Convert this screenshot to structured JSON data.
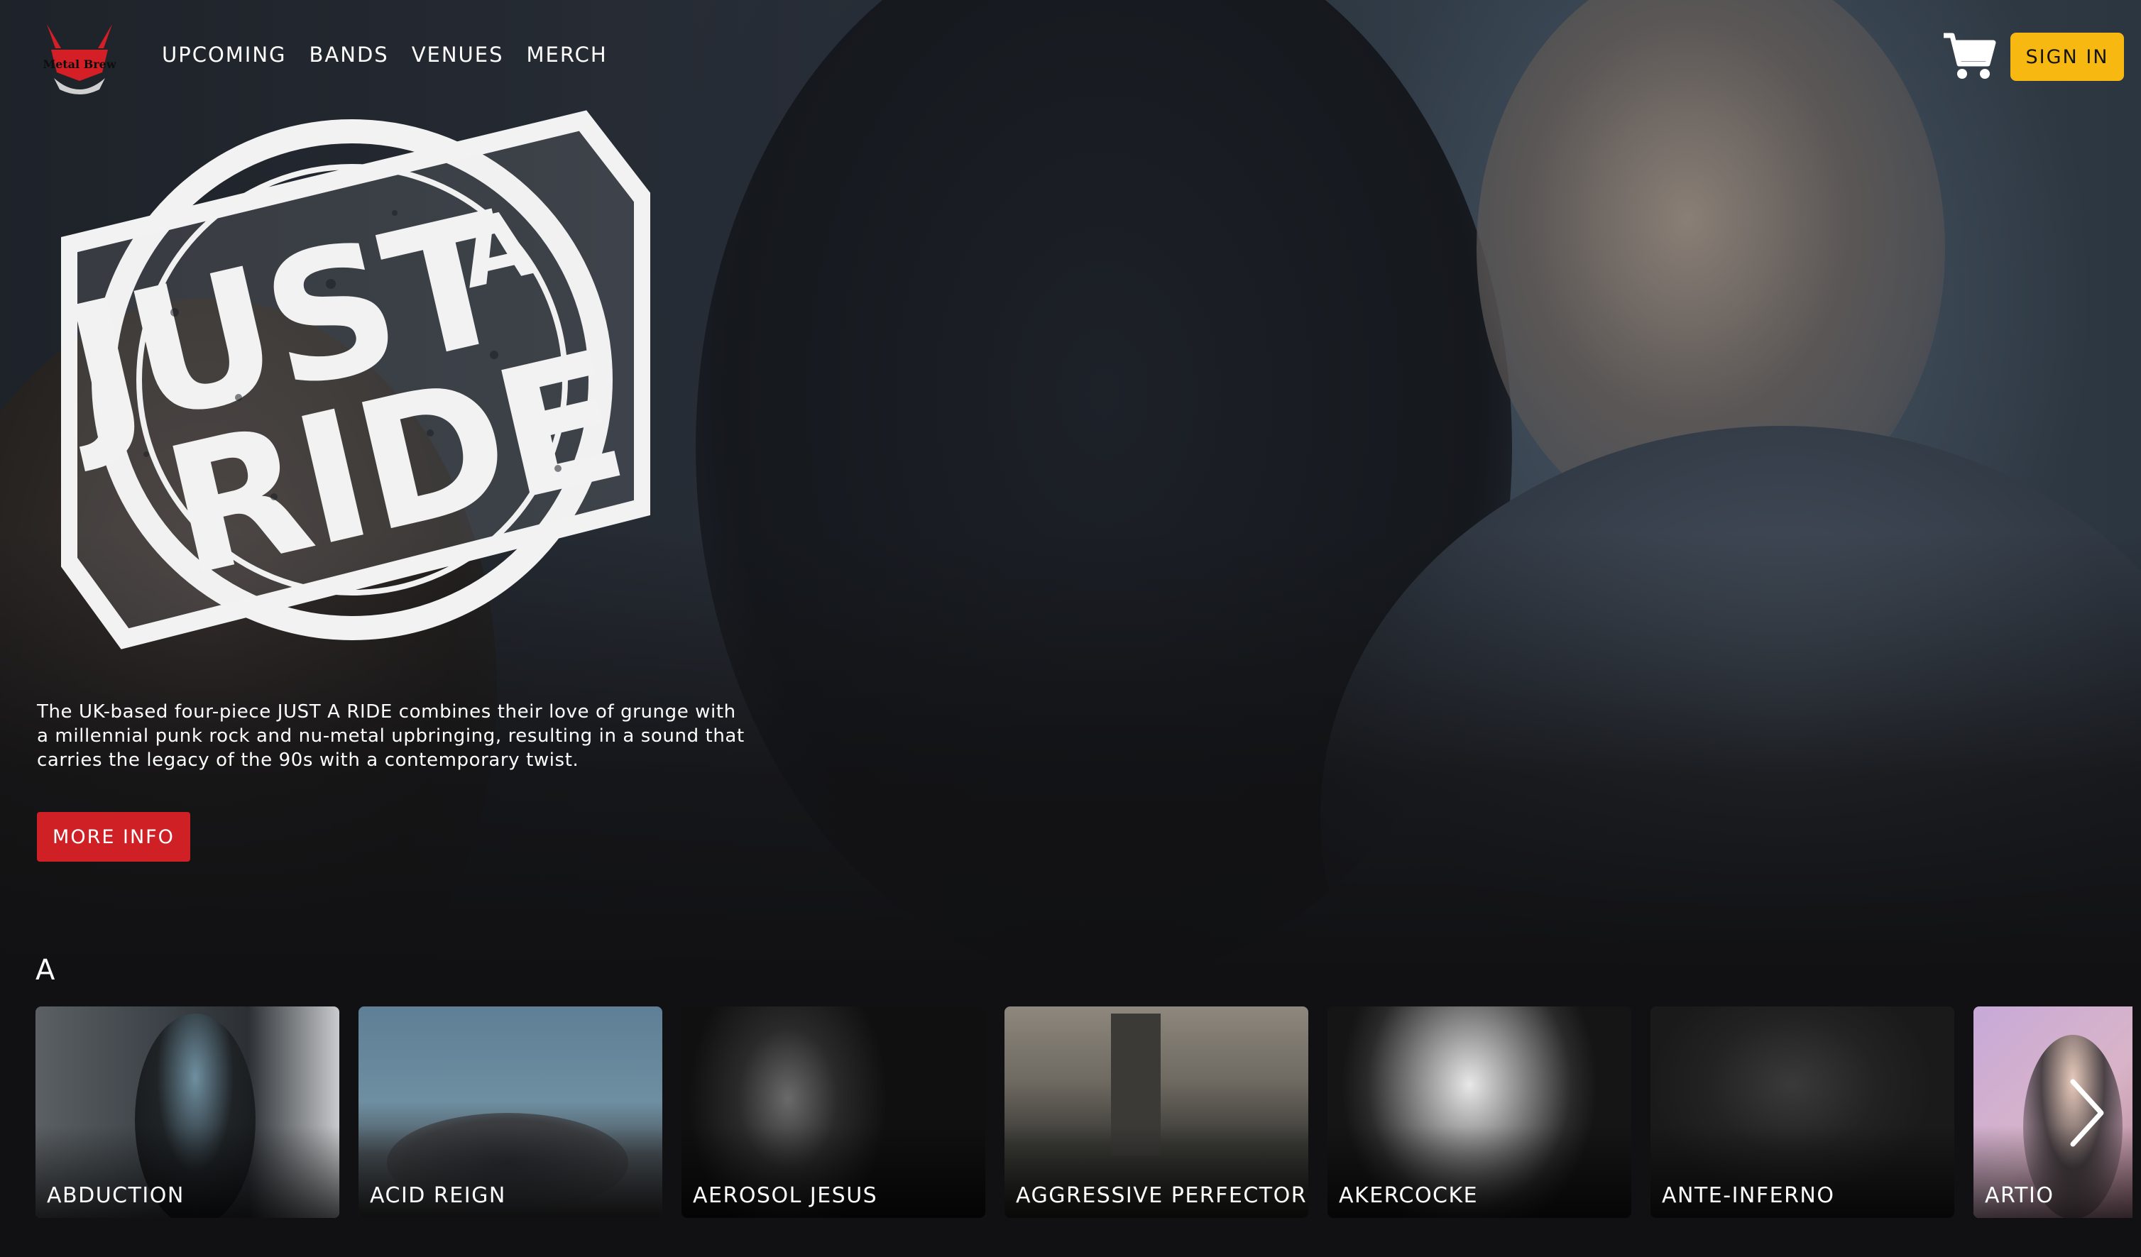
{
  "nav": {
    "logo_text": "Metal Brew",
    "items": [
      {
        "label": "UPCOMING"
      },
      {
        "label": "BANDS"
      },
      {
        "label": "VENUES"
      },
      {
        "label": "MERCH"
      }
    ],
    "cart_icon": "shopping-cart-icon",
    "sign_in_label": "SIGN IN"
  },
  "hero": {
    "band_logo_text": [
      "JUST",
      "A",
      "RIDE"
    ],
    "description": "The UK-based four-piece JUST A RIDE combines their love of grunge with a millennial punk rock and nu-metal upbringing, resulting in a sound that carries the legacy of the 90s with a contemporary twist.",
    "more_info_label": "MORE INFO"
  },
  "band_row": {
    "letter": "A",
    "next_icon": "chevron-right-icon",
    "bands": [
      {
        "name": "ABDUCTION"
      },
      {
        "name": "ACID REIGN"
      },
      {
        "name": "AEROSOL JESUS"
      },
      {
        "name": "AGGRESSIVE PERFECTOR"
      },
      {
        "name": "AKERCOCKE"
      },
      {
        "name": "ANTE-INFERNO"
      },
      {
        "name": "ARTIO"
      }
    ]
  },
  "colors": {
    "accent_yellow": "#f6b811",
    "accent_red": "#cf2026",
    "background": "#111113"
  }
}
